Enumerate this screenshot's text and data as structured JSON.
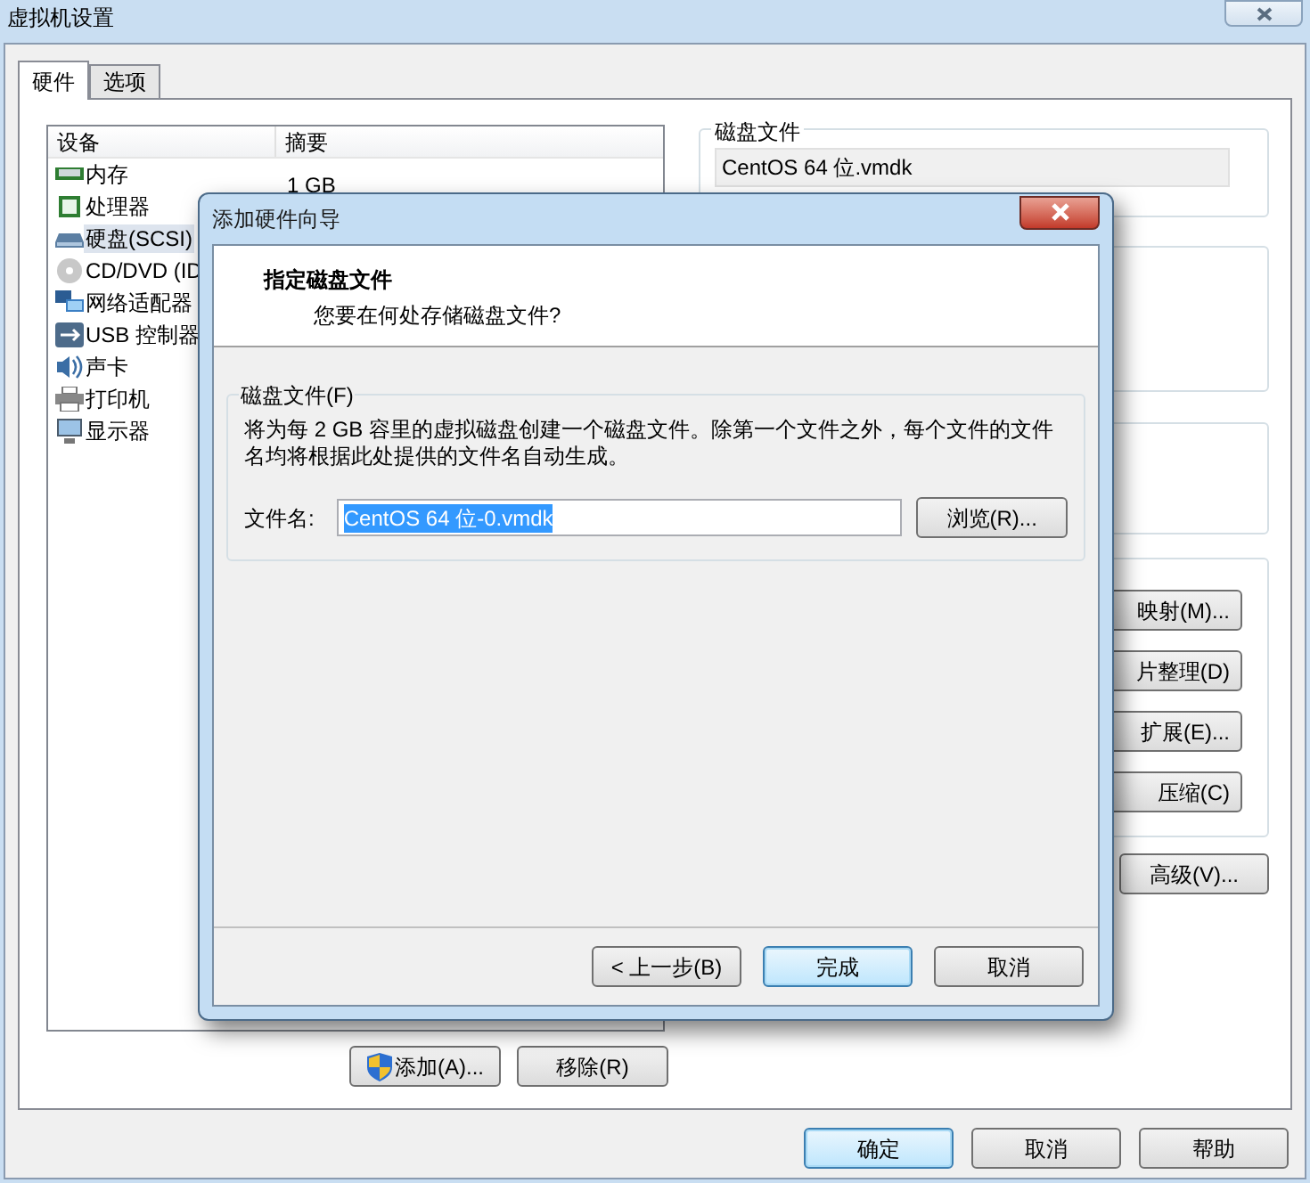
{
  "window": {
    "title": "虚拟机设置"
  },
  "tabs": [
    {
      "label": "硬件",
      "selected": true
    },
    {
      "label": "选项",
      "selected": false
    }
  ],
  "device_list": {
    "columns": [
      "设备",
      "摘要"
    ],
    "rows": [
      {
        "kind": "memory",
        "device": "内存",
        "summary": "1 GB",
        "selected": false
      },
      {
        "kind": "cpu",
        "device": "处理器",
        "selected": false
      },
      {
        "kind": "disk",
        "device": "硬盘(SCSI)",
        "selected": true
      },
      {
        "kind": "cdrom",
        "device": "CD/DVD (ID",
        "selected": false
      },
      {
        "kind": "network",
        "device": "网络适配器",
        "selected": false
      },
      {
        "kind": "usb",
        "device": "USB 控制器",
        "selected": false
      },
      {
        "kind": "sound",
        "device": "声卡",
        "selected": false
      },
      {
        "kind": "printer",
        "device": "打印机",
        "selected": false
      },
      {
        "kind": "display",
        "device": "显示器",
        "selected": false
      }
    ]
  },
  "disk_file_group": {
    "title": "磁盘文件",
    "value": "CentOS 64 位.vmdk"
  },
  "utility_buttons": [
    "映射(M)...",
    "片整理(D)",
    "扩展(E)...",
    "压缩(C)"
  ],
  "advanced_button": "高级(V)...",
  "list_buttons": [
    {
      "label": "添加(A)...",
      "shield": true
    },
    {
      "label": "移除(R)",
      "shield": false
    }
  ],
  "footer_buttons": [
    {
      "label": "确定",
      "default": true
    },
    {
      "label": "取消",
      "default": false
    },
    {
      "label": "帮助",
      "default": false
    }
  ],
  "dialog": {
    "title": "添加硬件向导",
    "heading": "指定磁盘文件",
    "subheading": "您要在何处存储磁盘文件?",
    "group_title": "磁盘文件(F)",
    "description": "将为每 2 GB 容里的虚拟磁盘创建一个磁盘文件。除第一个文件之外，每个文件的文件名均将根据此处提供的文件名自动生成。",
    "file_label": "文件名:",
    "file_value": "CentOS 64 位-0.vmdk",
    "browse_button": "浏览(R)...",
    "buttons": [
      {
        "label": "< 上一步(B)",
        "default": false
      },
      {
        "label": "完成",
        "default": true
      },
      {
        "label": "取消",
        "default": false
      }
    ]
  }
}
